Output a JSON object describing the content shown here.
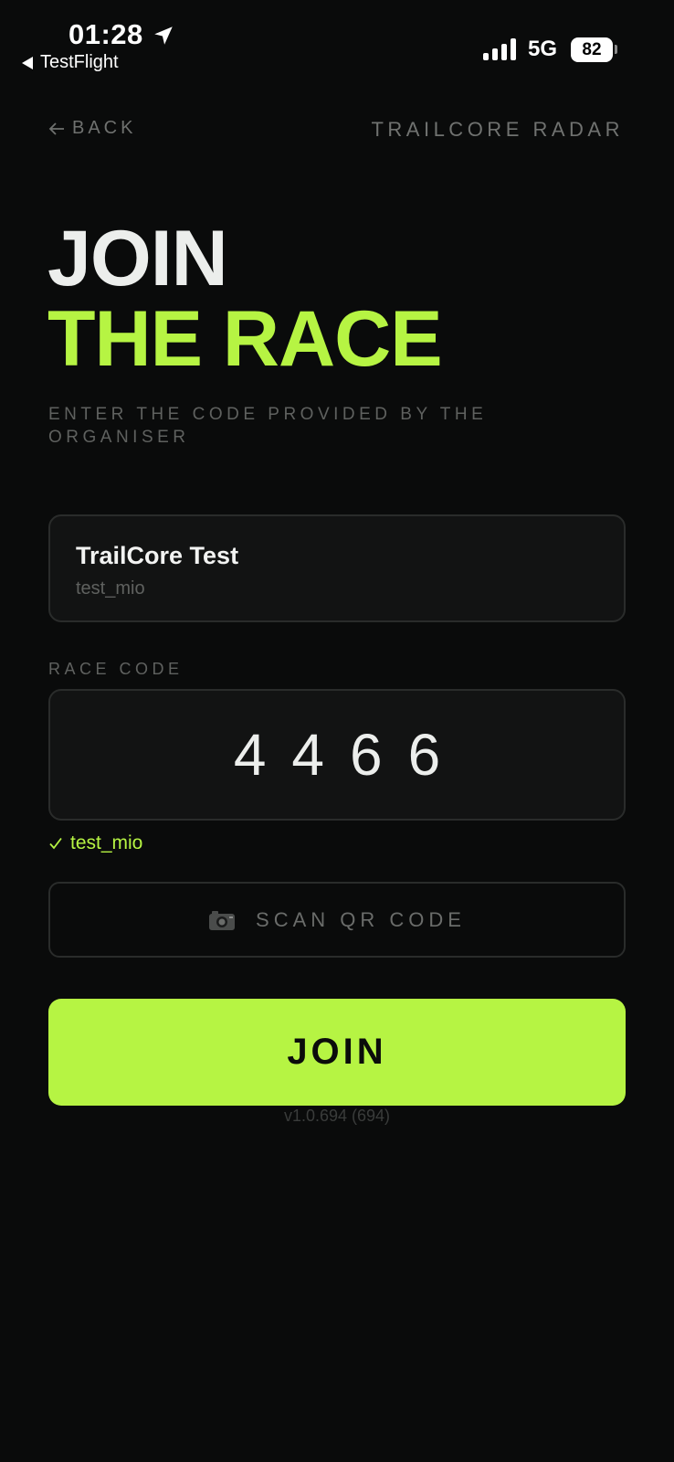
{
  "status_bar": {
    "time": "01:28",
    "back_app": "TestFlight",
    "network": "5G",
    "battery": "82"
  },
  "nav": {
    "back_label": "BACK",
    "brand": "TRAILCORE RADAR"
  },
  "heading": {
    "line1": "JOIN",
    "line2": "THE RACE",
    "subtitle": "ENTER THE CODE PROVIDED BY THE ORGANISER"
  },
  "race_card": {
    "name": "TrailCore Test",
    "id": "test_mio"
  },
  "race_code": {
    "label": "RACE CODE",
    "value": "4466",
    "validation": "test_mio"
  },
  "actions": {
    "scan_label": "SCAN QR CODE",
    "join_label": "JOIN"
  },
  "footer": {
    "version": "v1.0.694 (694)"
  },
  "colors": {
    "accent": "#b6f443",
    "background": "#0a0b0b"
  }
}
